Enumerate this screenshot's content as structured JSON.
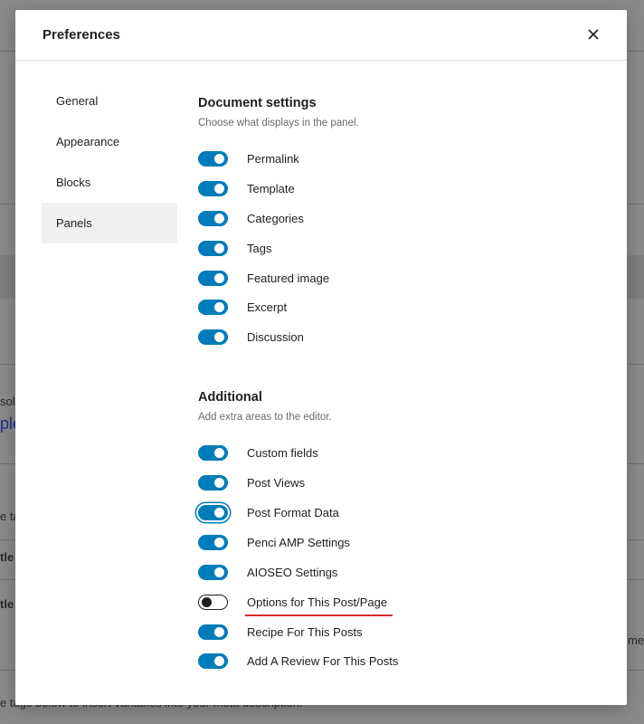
{
  "background": {
    "snippets": [
      {
        "text": "sol"
      },
      {
        "text": "ple"
      },
      {
        "text": "e ta"
      },
      {
        "text": "tle"
      },
      {
        "text": "tle"
      },
      {
        "text": "me"
      },
      {
        "text": "e tags below to insert variables into your meta description."
      }
    ]
  },
  "modal": {
    "title": "Preferences",
    "close_icon": "close-icon"
  },
  "nav": {
    "items": [
      {
        "label": "General"
      },
      {
        "label": "Appearance"
      },
      {
        "label": "Blocks"
      },
      {
        "label": "Panels",
        "active": true
      }
    ]
  },
  "document_settings": {
    "title": "Document settings",
    "description": "Choose what displays in the panel.",
    "options": [
      {
        "label": "Permalink",
        "enabled": true
      },
      {
        "label": "Template",
        "enabled": true
      },
      {
        "label": "Categories",
        "enabled": true
      },
      {
        "label": "Tags",
        "enabled": true
      },
      {
        "label": "Featured image",
        "enabled": true
      },
      {
        "label": "Excerpt",
        "enabled": true
      },
      {
        "label": "Discussion",
        "enabled": true
      }
    ]
  },
  "additional": {
    "title": "Additional",
    "description": "Add extra areas to the editor.",
    "options": [
      {
        "label": "Custom fields",
        "enabled": true
      },
      {
        "label": "Post Views",
        "enabled": true
      },
      {
        "label": "Post Format Data",
        "enabled": true,
        "focused": true
      },
      {
        "label": "Penci AMP Settings",
        "enabled": true
      },
      {
        "label": "AIOSEO Settings",
        "enabled": true
      },
      {
        "label": "Options for This Post/Page",
        "enabled": false,
        "highlighted": true
      },
      {
        "label": "Recipe For This Posts",
        "enabled": true
      },
      {
        "label": "Add A Review For This Posts",
        "enabled": true
      }
    ]
  },
  "colors": {
    "accent": "#007cba",
    "highlight_underline": "#d42b2b"
  }
}
